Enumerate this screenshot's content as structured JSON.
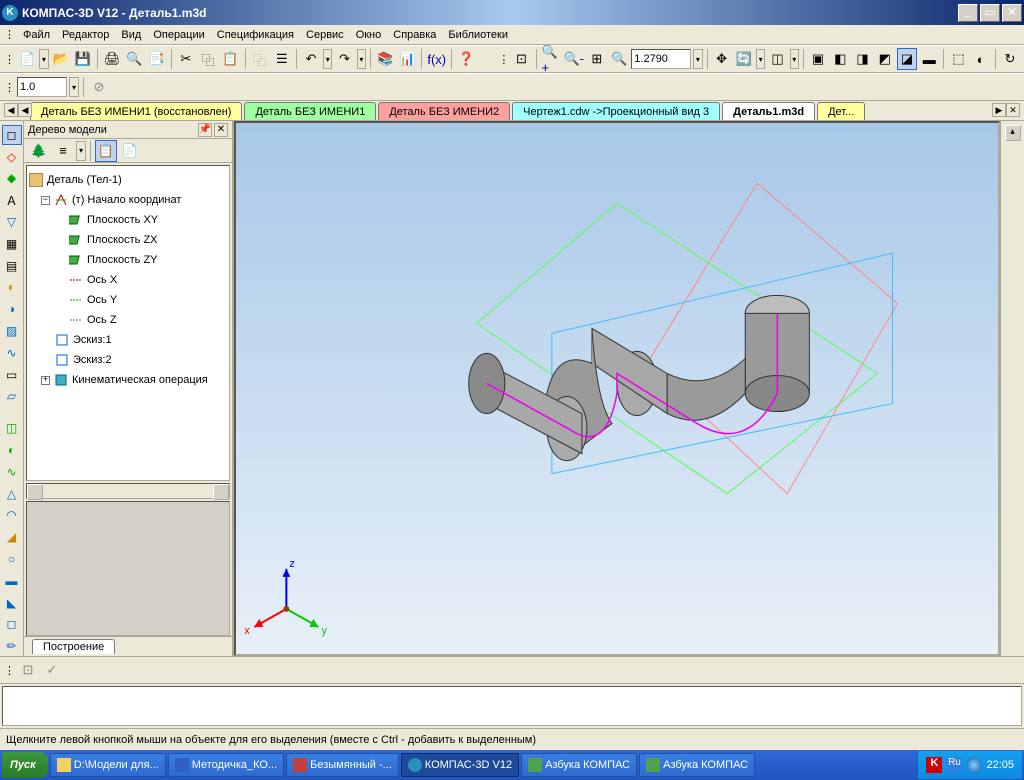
{
  "title": "КОМПАС-3D V12 - Деталь1.m3d",
  "menus": [
    "Файл",
    "Редактор",
    "Вид",
    "Операции",
    "Спецификация",
    "Сервис",
    "Окно",
    "Справка",
    "Библиотеки"
  ],
  "scale_value": "1.0",
  "zoom_value": "1.2790",
  "doctabs": [
    {
      "label": "Деталь БЕЗ ИМЕНИ1 (восстановлен)",
      "cls": "yellow"
    },
    {
      "label": "Деталь БЕЗ ИМЕНИ1",
      "cls": "green"
    },
    {
      "label": "Деталь БЕЗ ИМЕНИ2",
      "cls": "pink"
    },
    {
      "label": "Чертеж1.cdw ->Проекционный вид 3",
      "cls": "cyan"
    },
    {
      "label": "Деталь1.m3d",
      "cls": "white"
    },
    {
      "label": "Дет...",
      "cls": "yellow"
    }
  ],
  "panel": {
    "title": "Дерево модели",
    "root": "Деталь (Тел-1)",
    "origin": "(т) Начало координат",
    "planes": [
      "Плоскость XY",
      "Плоскость ZX",
      "Плоскость ZY"
    ],
    "axes": [
      "Ось X",
      "Ось Y",
      "Ось Z"
    ],
    "sketches": [
      "Эскиз:1",
      "Эскиз:2"
    ],
    "op": "Кинематическая операция",
    "tab": "Построение"
  },
  "status_text": "Щелкните левой кнопкой мыши на объекте для его выделения (вместе с Ctrl - добавить к выделенным)",
  "taskbar": {
    "start": "Пуск",
    "items": [
      "D:\\Модели для...",
      "Методичка_КО...",
      "Безымянный -...",
      "КОМПАС-3D V12",
      "Азбука КОМПАС",
      "Азбука КОМПАС"
    ],
    "active": 3,
    "lang": "Ru",
    "time": "22:05"
  },
  "triad": {
    "x": "x",
    "y": "y",
    "z": "z"
  },
  "icons": {
    "new": "📄",
    "open": "📂",
    "save": "💾",
    "print": "🖨",
    "preview": "🔍",
    "cut": "✂",
    "copy": "📋",
    "paste": "📋",
    "undo": "↶",
    "redo": "↷",
    "zoom_in": "🔍",
    "zoom_out": "🔍",
    "zoom_fit": "⊡",
    "pan": "✋",
    "rotate": "🔄",
    "cube": "◻",
    "sphere": "○",
    "help": "?",
    "fx": "f(x)",
    "arrow": "↖",
    "grid": "▦",
    "copy2": "⿻",
    "props": "☰"
  }
}
